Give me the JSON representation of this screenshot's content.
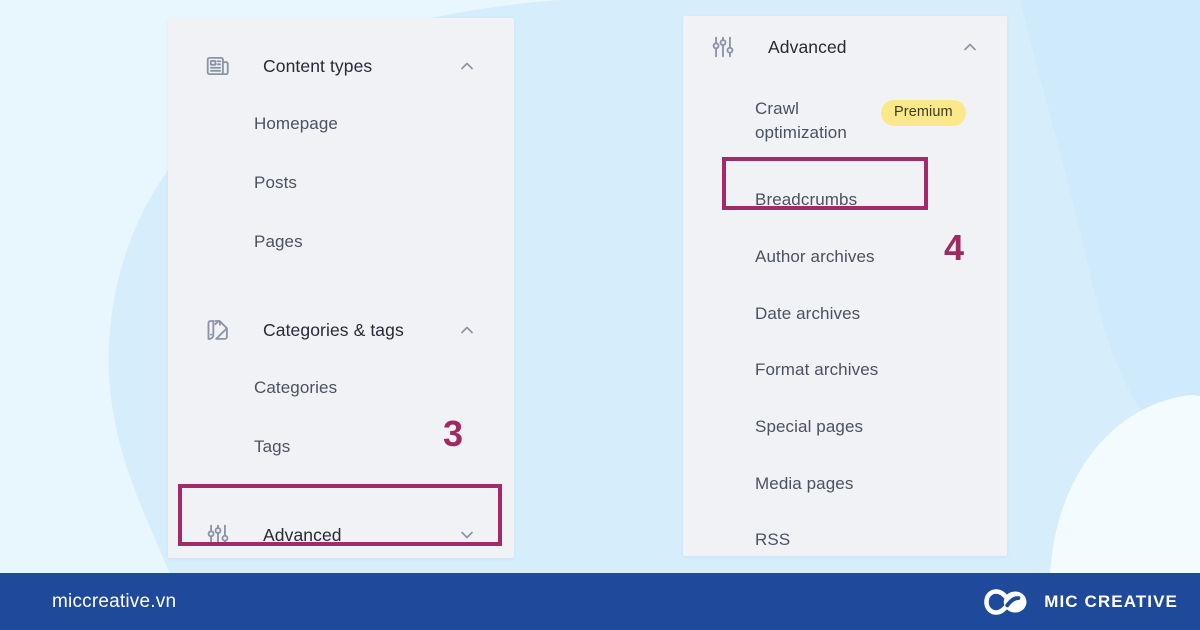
{
  "theme": {
    "page_background": "#d6edfb",
    "panel_background": "#f1f2f6",
    "highlight_color": "#a32a68",
    "step_number_color": "#9d2b62",
    "badge_background": "#fbe88b",
    "badge_text_color": "#3b3a24",
    "footer_background": "#1f4a9b",
    "label_color": "#252a33",
    "sublabel_color": "#4a5160",
    "icon_color": "#8a94a6"
  },
  "left_panel": {
    "groups": [
      {
        "label": "Content types",
        "icon": "newspaper-icon",
        "chevron": "chevron-up-icon",
        "items": [
          {
            "label": "Homepage"
          },
          {
            "label": "Posts"
          },
          {
            "label": "Pages"
          }
        ]
      },
      {
        "label": "Categories & tags",
        "icon": "color-swatch-icon",
        "chevron": "chevron-up-icon",
        "items": [
          {
            "label": "Categories"
          },
          {
            "label": "Tags"
          }
        ]
      },
      {
        "label": "Advanced",
        "icon": "sliders-icon",
        "chevron": "chevron-down-icon",
        "highlighted": true,
        "items": []
      }
    ],
    "step_marker": "3"
  },
  "right_panel": {
    "group": {
      "label": "Advanced",
      "icon": "sliders-icon",
      "chevron": "chevron-up-icon"
    },
    "items": [
      {
        "label": "Crawl optimization",
        "badge": "Premium"
      },
      {
        "label": "Breadcrumbs",
        "highlighted": true
      },
      {
        "label": "Author archives"
      },
      {
        "label": "Date archives"
      },
      {
        "label": "Format archives"
      },
      {
        "label": "Special pages"
      },
      {
        "label": "Media pages"
      },
      {
        "label": "RSS"
      }
    ],
    "step_marker": "4"
  },
  "footer": {
    "url": "miccreative.vn",
    "brand_name": "MIC CREATIVE",
    "logo_icon": "infinity-loops-icon"
  }
}
